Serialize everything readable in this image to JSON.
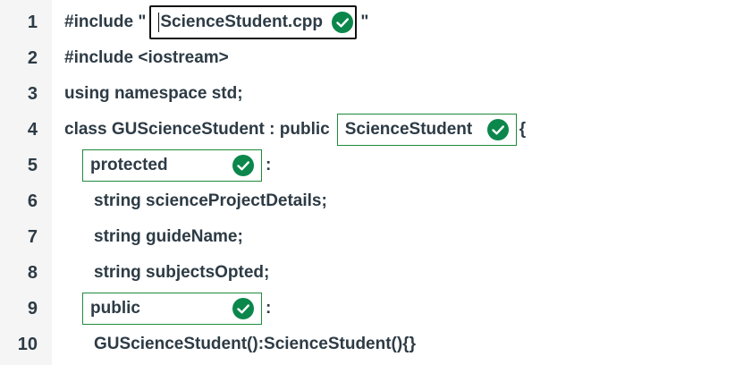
{
  "lines": [
    {
      "num": "1",
      "pre": "#include \"",
      "blank": "ScienceStudent.cpp",
      "post": "\""
    },
    {
      "num": "2",
      "text": "#include <iostream>"
    },
    {
      "num": "3",
      "text": "using namespace std;"
    },
    {
      "num": "4",
      "pre": "class GUScienceStudent : public",
      "blank": "ScienceStudent",
      "post": "{"
    },
    {
      "num": "5",
      "blank": "protected",
      "post": ":"
    },
    {
      "num": "6",
      "text": "string scienceProjectDetails;"
    },
    {
      "num": "7",
      "text": "string guideName;"
    },
    {
      "num": "8",
      "text": "string subjectsOpted;"
    },
    {
      "num": "9",
      "blank": "public",
      "post": ":"
    },
    {
      "num": "10",
      "text": "GUScienceStudent():ScienceStudent(){}"
    }
  ],
  "colors": {
    "correct_check": "#0b874b",
    "blank_border": "#1e8a3c",
    "gutter_bg": "#f5f5f5",
    "text": "#2d3b45"
  },
  "icons": {
    "blank_status": "check-circle-icon"
  }
}
